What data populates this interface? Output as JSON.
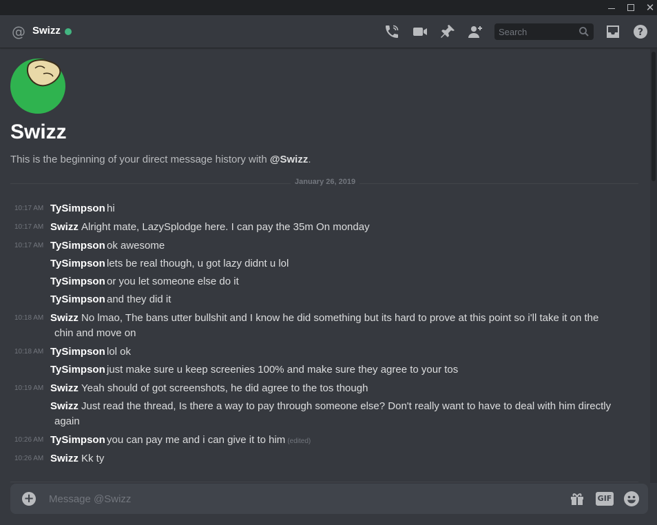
{
  "header": {
    "channel_name": "Swizz",
    "status_color": "#43b581",
    "search_placeholder": "Search",
    "icons": [
      "start-voice-call-icon",
      "start-video-call-icon",
      "pinned-messages-icon",
      "add-friends-icon",
      "inbox-icon",
      "help-icon"
    ]
  },
  "intro": {
    "name": "Swizz",
    "text_prefix": "This is the beginning of your direct message history with ",
    "mention": "@Swizz",
    "text_suffix": "."
  },
  "dividers": [
    {
      "label": "January 26, 2019"
    }
  ],
  "messages": [
    {
      "time": "10:17 AM",
      "author": "TySimpson",
      "text": "hi"
    },
    {
      "time": "10:17 AM",
      "author": "Swizz",
      "text": "Alright mate, LazySplodge here. I can pay the 35m On monday"
    },
    {
      "time": "10:17 AM",
      "author": "TySimpson",
      "text": "ok awesome"
    },
    {
      "time": "",
      "author": "TySimpson",
      "text": "lets be real though, u got lazy didnt u lol"
    },
    {
      "time": "",
      "author": "TySimpson",
      "text": "or you let someone else do it"
    },
    {
      "time": "",
      "author": "TySimpson",
      "text": "and they did it"
    },
    {
      "time": "10:18 AM",
      "author": "Swizz",
      "text": "No lmao, The bans utter bullshit and I know he did something but its hard to prove at this point so i'll take it on the",
      "text_line2": "chin and move on"
    },
    {
      "time": "10:18 AM",
      "author": "TySimpson",
      "text": "lol ok"
    },
    {
      "time": "",
      "author": "TySimpson",
      "text": "just make sure u keep screenies 100% and make sure they agree to your tos"
    },
    {
      "time": "10:19 AM",
      "author": "Swizz",
      "text": "Yeah should of got screenshots, he did agree to the tos though"
    },
    {
      "time": "",
      "author": "Swizz",
      "text": "Just read the thread, Is there a way to pay through someone else? Don't really want to have to deal with him directly",
      "text_line2": "again"
    },
    {
      "time": "10:26 AM",
      "author": "TySimpson",
      "text": "you can pay me and i can give it to him",
      "edited": "(edited)"
    },
    {
      "time": "10:26 AM",
      "author": "Swizz",
      "text": "Kk ty"
    }
  ],
  "composer": {
    "placeholder": "Message @Swizz",
    "gif_label": "GIF"
  },
  "window": {
    "close_glyph": "✕"
  }
}
